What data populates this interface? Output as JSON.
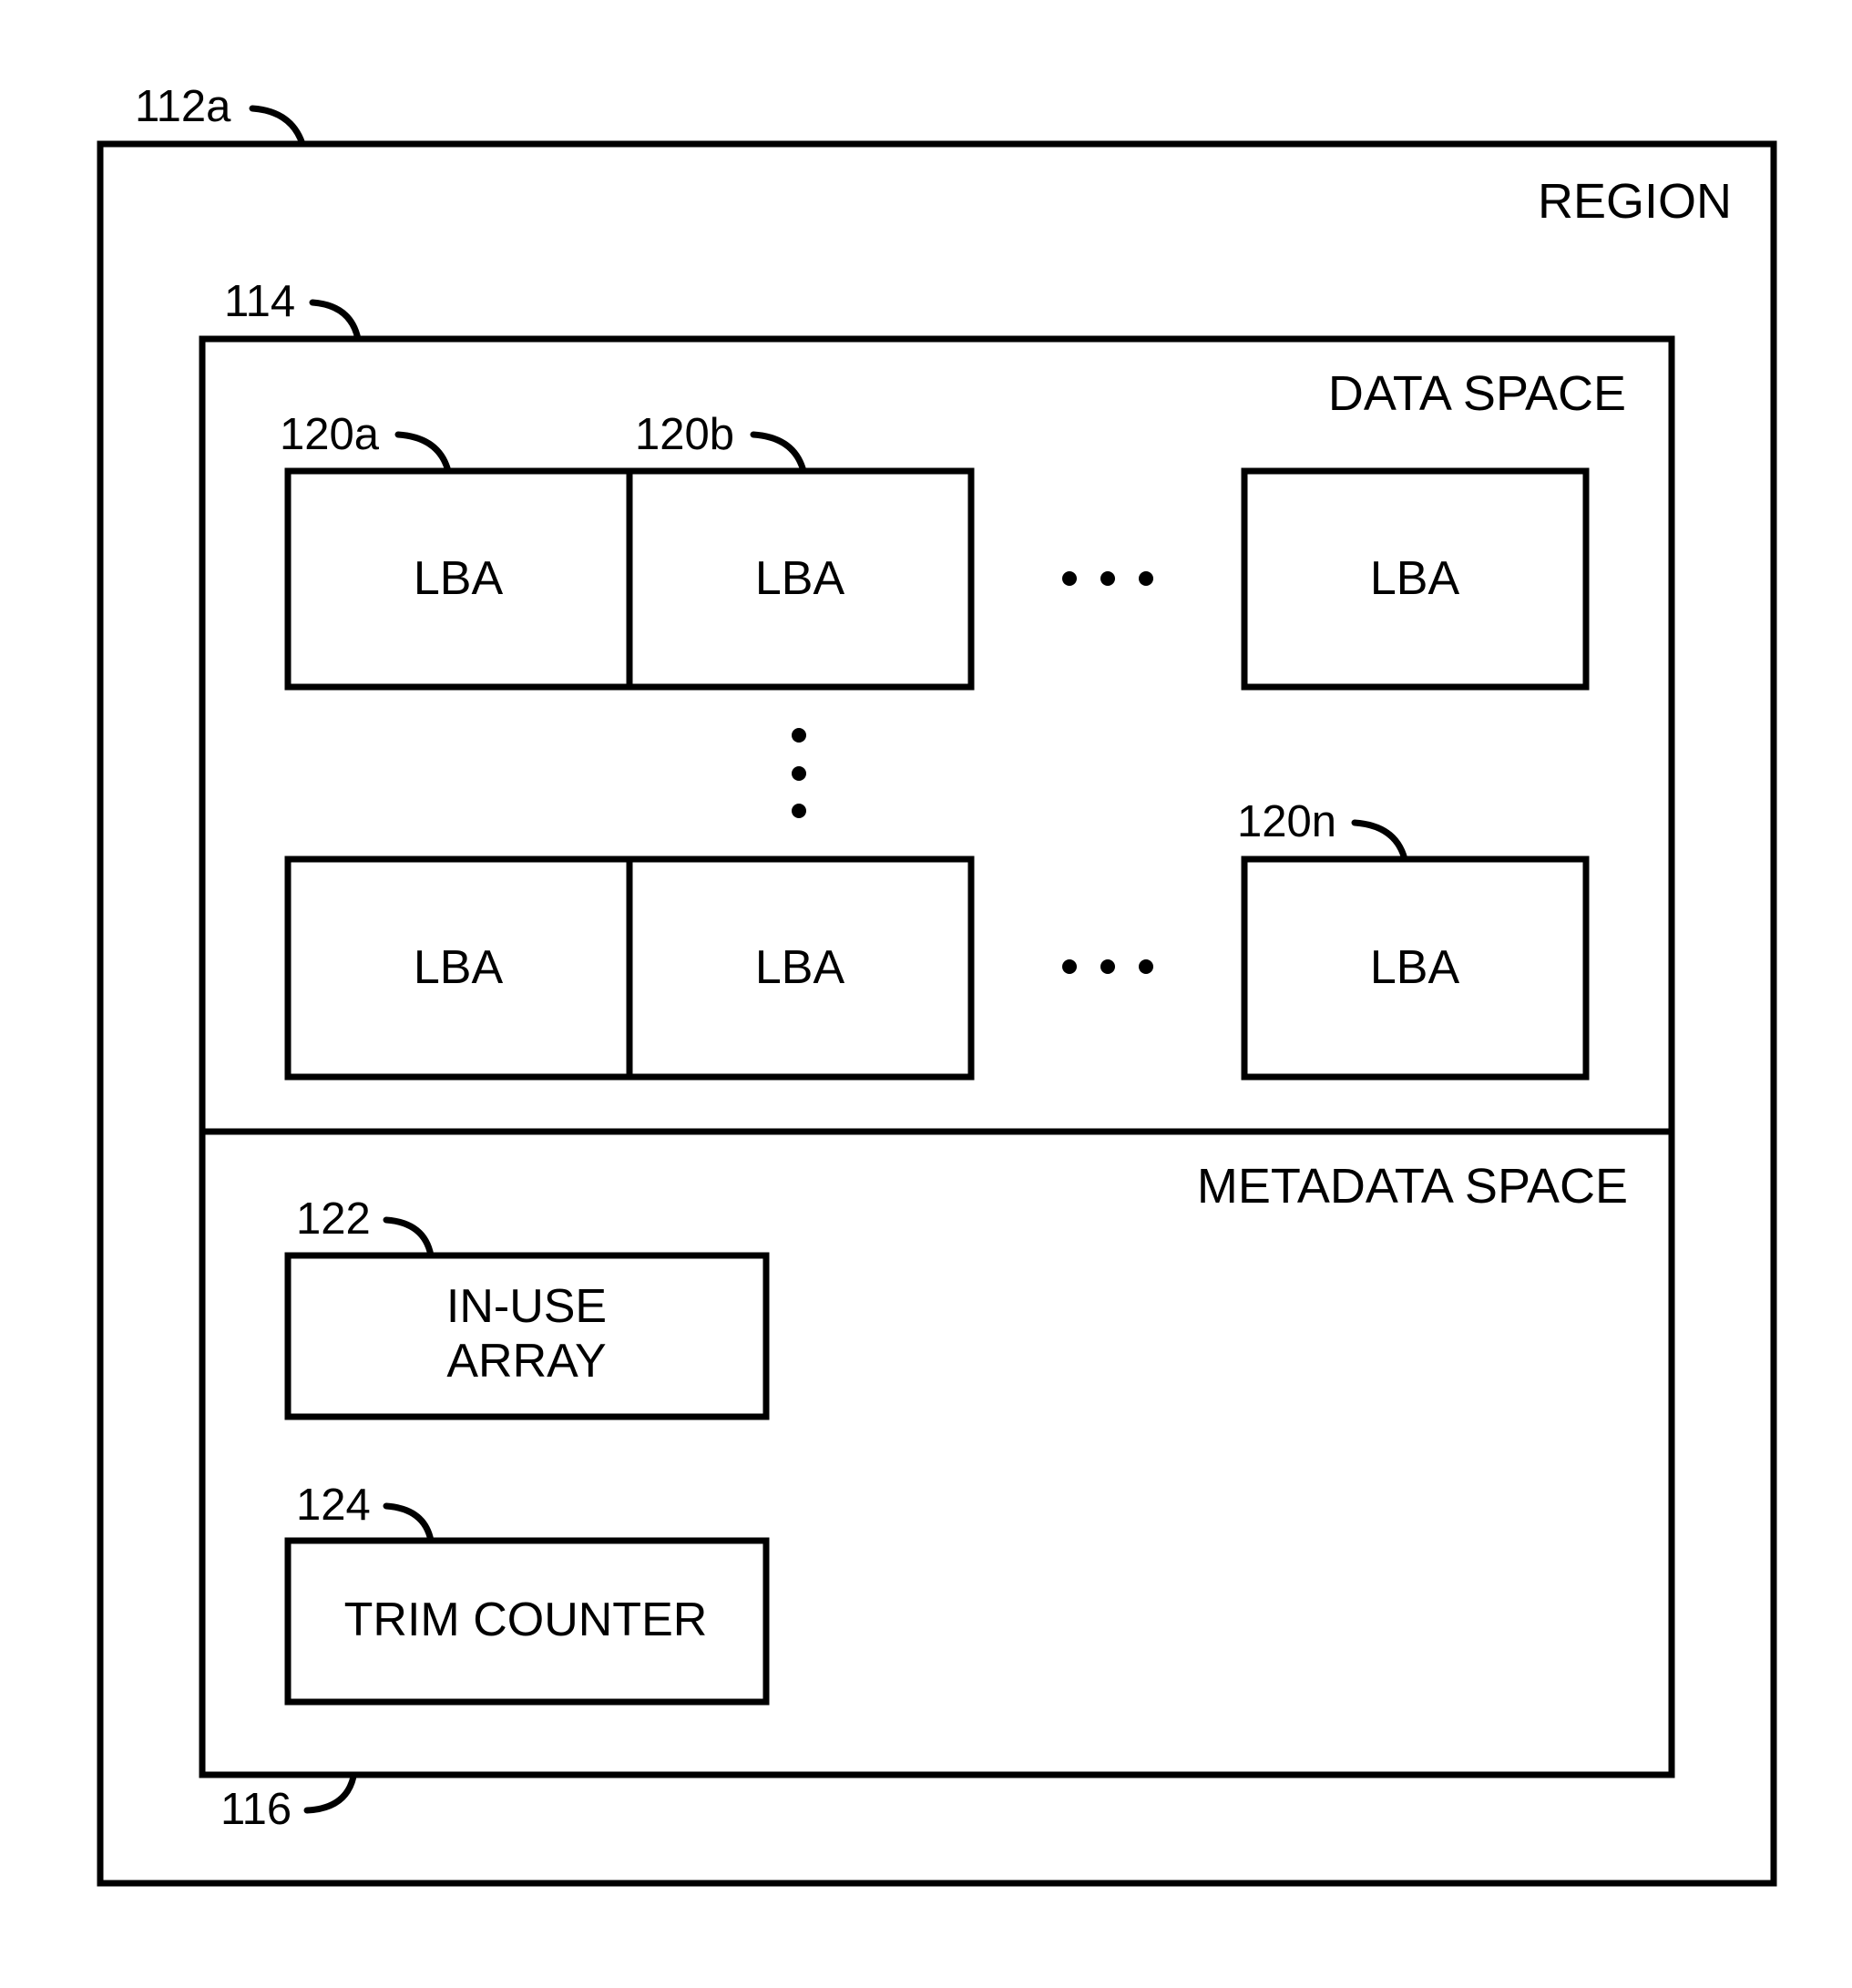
{
  "figure": {
    "region": {
      "ref": "112a",
      "title": "REGION"
    },
    "data_space": {
      "ref": "114",
      "title": "DATA SPACE",
      "rows": [
        {
          "cells": [
            {
              "ref": "120a",
              "label": "LBA"
            },
            {
              "ref": "120b",
              "label": "LBA"
            },
            {
              "ref": "",
              "label": "LBA"
            }
          ]
        },
        {
          "cells": [
            {
              "ref": "",
              "label": "LBA"
            },
            {
              "ref": "",
              "label": "LBA"
            },
            {
              "ref": "120n",
              "label": "LBA"
            }
          ]
        }
      ],
      "ellipsis_horizontal": "•••",
      "ellipsis_vertical": "⋮"
    },
    "metadata_space": {
      "ref": "116",
      "title": "METADATA SPACE",
      "in_use_array": {
        "ref": "122",
        "label_line1": "IN-USE",
        "label_line2": "ARRAY"
      },
      "trim_counter": {
        "ref": "124",
        "label": "TRIM COUNTER"
      }
    }
  }
}
